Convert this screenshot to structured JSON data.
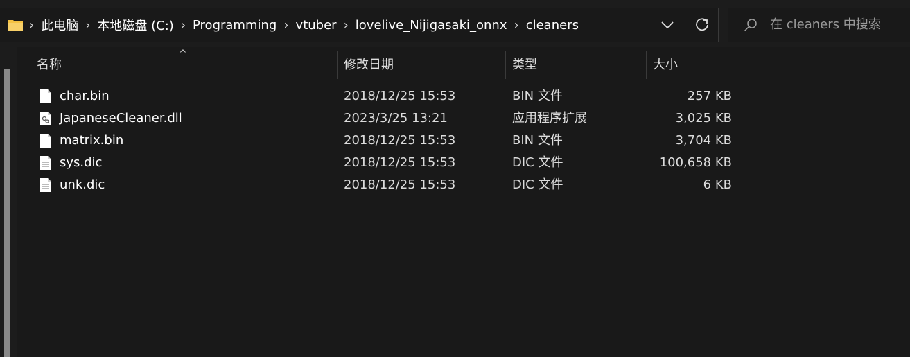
{
  "addressbar": {
    "crumbs": [
      "此电脑",
      "本地磁盘 (C:)",
      "Programming",
      "vtuber",
      "lovelive_Nijigasaki_onnx",
      "cleaners"
    ],
    "folder_icon": "folder-icon",
    "dropdown_icon": "chevron-down-icon",
    "refresh_icon": "refresh-icon"
  },
  "search": {
    "placeholder": "在 cleaners 中搜索",
    "icon": "search-icon"
  },
  "columns": {
    "name": "名称",
    "date": "修改日期",
    "type": "类型",
    "size": "大小"
  },
  "files": [
    {
      "name": "char.bin",
      "date": "2018/12/25 15:53",
      "type": "BIN 文件",
      "size": "257 KB",
      "icon": "file-icon"
    },
    {
      "name": "JapaneseCleaner.dll",
      "date": "2023/3/25 13:21",
      "type": "应用程序扩展",
      "size": "3,025 KB",
      "icon": "dll-file-icon"
    },
    {
      "name": "matrix.bin",
      "date": "2018/12/25 15:53",
      "type": "BIN 文件",
      "size": "3,704 KB",
      "icon": "file-icon"
    },
    {
      "name": "sys.dic",
      "date": "2018/12/25 15:53",
      "type": "DIC 文件",
      "size": "100,658 KB",
      "icon": "text-file-icon"
    },
    {
      "name": "unk.dic",
      "date": "2018/12/25 15:53",
      "type": "DIC 文件",
      "size": "6 KB",
      "icon": "text-file-icon"
    }
  ],
  "colors": {
    "background": "#191919",
    "text": "#ffffff",
    "folder": "#f5c242"
  }
}
